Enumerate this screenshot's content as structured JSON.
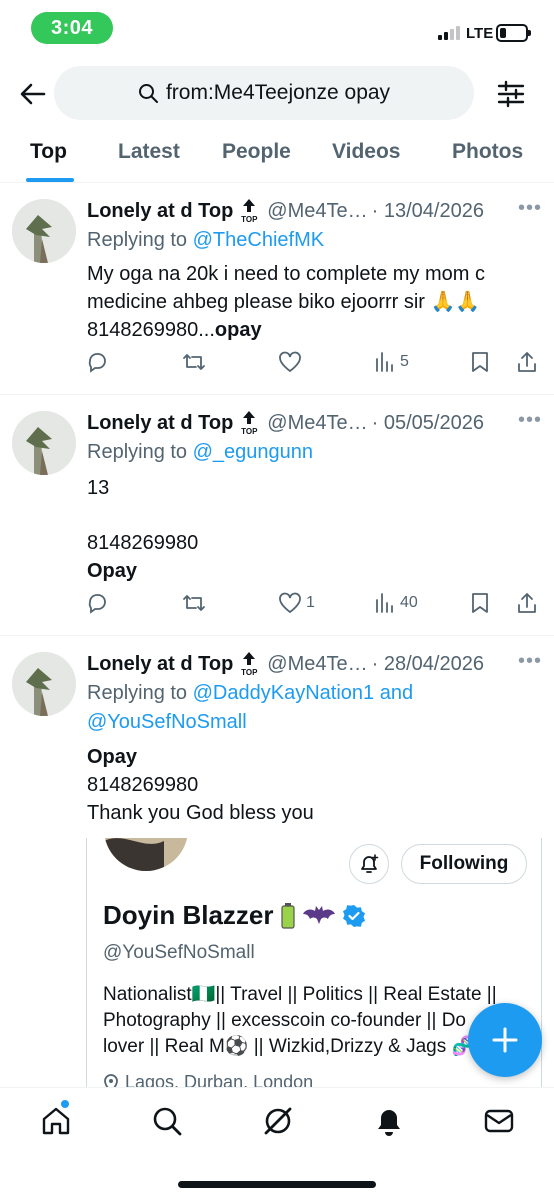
{
  "status": {
    "time": "3:04",
    "network": "LTE",
    "battery_level": 0.25
  },
  "search": {
    "query": "from:Me4Teejonze opay"
  },
  "tabs": [
    {
      "label": "Top",
      "active": true
    },
    {
      "label": "Latest"
    },
    {
      "label": "People"
    },
    {
      "label": "Videos"
    },
    {
      "label": "Photos"
    }
  ],
  "tweets": [
    {
      "name": "Lonely at d Top",
      "badge": "TOP",
      "handle": "@Me4Te…",
      "date": "· 13/04/2026",
      "replying_prefix": "Replying to ",
      "replying_to": "@TheChiefMK",
      "text_line1": "My oga na 20k i need to complete my mom c",
      "text_line2": "medicine ahbeg please biko ejoorrr sir 🙏🙏",
      "text_line3_plain": "8148269980...",
      "text_line3_bold": "opay",
      "likes": "",
      "views": "5"
    },
    {
      "name": "Lonely at d Top",
      "badge": "TOP",
      "handle": "@Me4Te…",
      "date": "· 05/05/2026",
      "replying_prefix": "Replying to ",
      "replying_to": "@_egungunn",
      "line1": "13",
      "line2": "8148269980",
      "line3_bold": "Opay",
      "likes": "1",
      "views": "40"
    },
    {
      "name": "Lonely at d Top",
      "badge": "TOP",
      "handle": "@Me4Te…",
      "date": "· 28/04/2026",
      "replying_prefix": "Replying to ",
      "replying_to_1": "@DaddyKayNation1",
      "replying_and": " and",
      "replying_to_2": "@YouSefNoSmall",
      "line1_bold": "Opay",
      "line2": "8148269980",
      "line3": "Thank you God bless you"
    }
  ],
  "profile_card": {
    "follow_label": "Following",
    "name": "Doyin Blazzer",
    "handle": "@YouSefNoSmall",
    "bio_line1": "Nationalist🇳🇬|| Travel || Politics || Real Estate ||",
    "bio_line2": "Photography || excesscoin co-founder || Do",
    "bio_line3": "lover || Real M⚽ || Wizkid,Drizzy & Jags 🧬",
    "location": "Lagos, Durban, London"
  },
  "colors": {
    "accent": "#1d9bf0",
    "status_green": "#34c759",
    "muted": "#536471"
  }
}
